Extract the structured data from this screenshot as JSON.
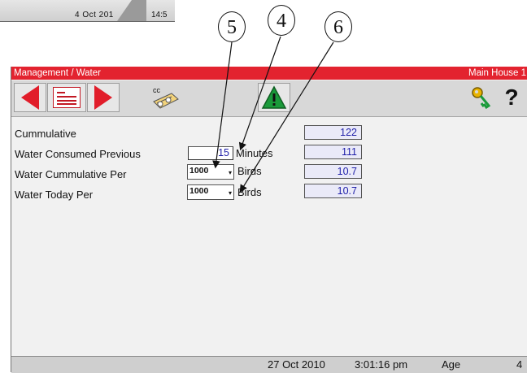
{
  "top_status": {
    "date": "4 Oct 201",
    "time": "14:5"
  },
  "callouts": [
    "5",
    "4",
    "6"
  ],
  "window": {
    "breadcrumb": "Management / Water",
    "house": "Main House 1"
  },
  "toolbar": {
    "cc_label": "cc",
    "help_label": "?",
    "icons": [
      "previous-arrow-icon",
      "report-icon",
      "next-arrow-icon",
      "cc-copy-icon",
      "warning-icon",
      "key-icon",
      "help-icon"
    ],
    "colors": {
      "arrow": "#e11d2a",
      "warning": "#1a9a3a"
    }
  },
  "rows": {
    "cumulative": {
      "label": "Cummulative",
      "value": "122"
    },
    "consumed_previous": {
      "label": "Water Consumed Previous",
      "input_value": "15",
      "unit": "Minutes",
      "value": "111"
    },
    "cumulative_per": {
      "label": "Water Cummulative Per",
      "select_value": "1000",
      "unit": "Birds",
      "value": "10.7"
    },
    "today_per": {
      "label": "Water Today Per",
      "select_value": "1000",
      "unit": "Birds",
      "value": "10.7"
    }
  },
  "status": {
    "date": "27 Oct 2010",
    "time": "3:01:16 pm",
    "age_label": "Age",
    "age_value": "4"
  }
}
